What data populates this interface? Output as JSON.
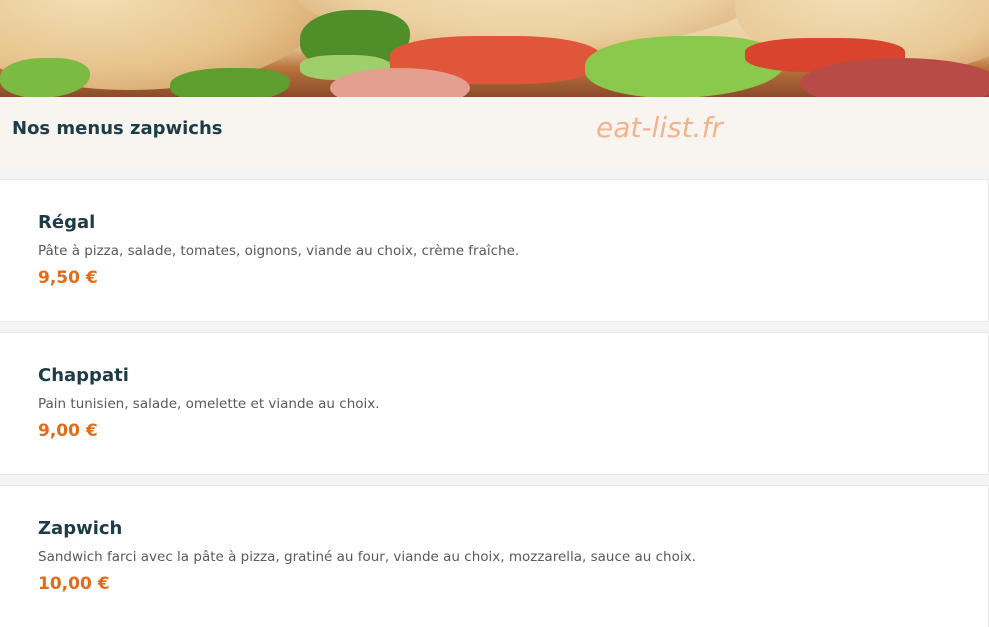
{
  "banner": {
    "alt": "sandwich-banner-image"
  },
  "header": {
    "title": "Nos menus zapwichs",
    "watermark": "eat-list.fr"
  },
  "colors": {
    "title": "#1d3c47",
    "price": "#e36a17",
    "description": "#555b5e",
    "watermark": "#f2b48c",
    "header_bg": "#f8f4f0"
  },
  "menu": {
    "items": [
      {
        "name": "Régal",
        "description": "Pâte à pizza, salade, tomates, oignons, viande au choix, crème fraîche.",
        "price": "9,50 €"
      },
      {
        "name": "Chappati",
        "description": "Pain tunisien, salade, omelette et viande au choix.",
        "price": "9,00 €"
      },
      {
        "name": "Zapwich",
        "description": "Sandwich farci avec la pâte à pizza, gratiné au four, viande au choix, mozzarella, sauce au choix.",
        "price": "10,00 €"
      }
    ]
  }
}
